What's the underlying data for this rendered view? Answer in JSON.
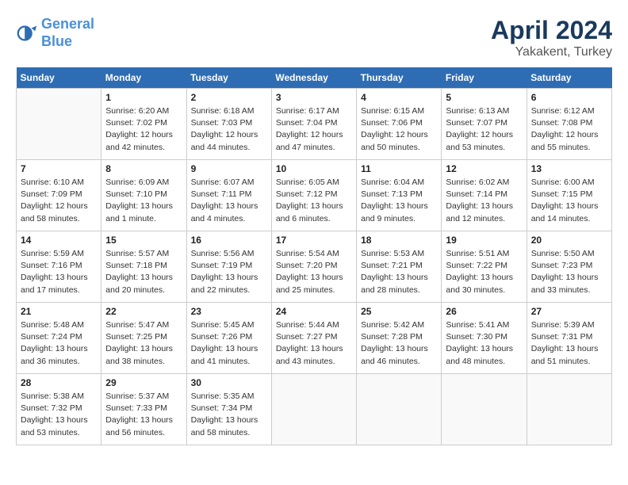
{
  "header": {
    "logo_line1": "General",
    "logo_line2": "Blue",
    "month": "April 2024",
    "location": "Yakakent, Turkey"
  },
  "weekdays": [
    "Sunday",
    "Monday",
    "Tuesday",
    "Wednesday",
    "Thursday",
    "Friday",
    "Saturday"
  ],
  "weeks": [
    [
      {
        "day": "",
        "info": ""
      },
      {
        "day": "1",
        "info": "Sunrise: 6:20 AM\nSunset: 7:02 PM\nDaylight: 12 hours\nand 42 minutes."
      },
      {
        "day": "2",
        "info": "Sunrise: 6:18 AM\nSunset: 7:03 PM\nDaylight: 12 hours\nand 44 minutes."
      },
      {
        "day": "3",
        "info": "Sunrise: 6:17 AM\nSunset: 7:04 PM\nDaylight: 12 hours\nand 47 minutes."
      },
      {
        "day": "4",
        "info": "Sunrise: 6:15 AM\nSunset: 7:06 PM\nDaylight: 12 hours\nand 50 minutes."
      },
      {
        "day": "5",
        "info": "Sunrise: 6:13 AM\nSunset: 7:07 PM\nDaylight: 12 hours\nand 53 minutes."
      },
      {
        "day": "6",
        "info": "Sunrise: 6:12 AM\nSunset: 7:08 PM\nDaylight: 12 hours\nand 55 minutes."
      }
    ],
    [
      {
        "day": "7",
        "info": "Sunrise: 6:10 AM\nSunset: 7:09 PM\nDaylight: 12 hours\nand 58 minutes."
      },
      {
        "day": "8",
        "info": "Sunrise: 6:09 AM\nSunset: 7:10 PM\nDaylight: 13 hours\nand 1 minute."
      },
      {
        "day": "9",
        "info": "Sunrise: 6:07 AM\nSunset: 7:11 PM\nDaylight: 13 hours\nand 4 minutes."
      },
      {
        "day": "10",
        "info": "Sunrise: 6:05 AM\nSunset: 7:12 PM\nDaylight: 13 hours\nand 6 minutes."
      },
      {
        "day": "11",
        "info": "Sunrise: 6:04 AM\nSunset: 7:13 PM\nDaylight: 13 hours\nand 9 minutes."
      },
      {
        "day": "12",
        "info": "Sunrise: 6:02 AM\nSunset: 7:14 PM\nDaylight: 13 hours\nand 12 minutes."
      },
      {
        "day": "13",
        "info": "Sunrise: 6:00 AM\nSunset: 7:15 PM\nDaylight: 13 hours\nand 14 minutes."
      }
    ],
    [
      {
        "day": "14",
        "info": "Sunrise: 5:59 AM\nSunset: 7:16 PM\nDaylight: 13 hours\nand 17 minutes."
      },
      {
        "day": "15",
        "info": "Sunrise: 5:57 AM\nSunset: 7:18 PM\nDaylight: 13 hours\nand 20 minutes."
      },
      {
        "day": "16",
        "info": "Sunrise: 5:56 AM\nSunset: 7:19 PM\nDaylight: 13 hours\nand 22 minutes."
      },
      {
        "day": "17",
        "info": "Sunrise: 5:54 AM\nSunset: 7:20 PM\nDaylight: 13 hours\nand 25 minutes."
      },
      {
        "day": "18",
        "info": "Sunrise: 5:53 AM\nSunset: 7:21 PM\nDaylight: 13 hours\nand 28 minutes."
      },
      {
        "day": "19",
        "info": "Sunrise: 5:51 AM\nSunset: 7:22 PM\nDaylight: 13 hours\nand 30 minutes."
      },
      {
        "day": "20",
        "info": "Sunrise: 5:50 AM\nSunset: 7:23 PM\nDaylight: 13 hours\nand 33 minutes."
      }
    ],
    [
      {
        "day": "21",
        "info": "Sunrise: 5:48 AM\nSunset: 7:24 PM\nDaylight: 13 hours\nand 36 minutes."
      },
      {
        "day": "22",
        "info": "Sunrise: 5:47 AM\nSunset: 7:25 PM\nDaylight: 13 hours\nand 38 minutes."
      },
      {
        "day": "23",
        "info": "Sunrise: 5:45 AM\nSunset: 7:26 PM\nDaylight: 13 hours\nand 41 minutes."
      },
      {
        "day": "24",
        "info": "Sunrise: 5:44 AM\nSunset: 7:27 PM\nDaylight: 13 hours\nand 43 minutes."
      },
      {
        "day": "25",
        "info": "Sunrise: 5:42 AM\nSunset: 7:28 PM\nDaylight: 13 hours\nand 46 minutes."
      },
      {
        "day": "26",
        "info": "Sunrise: 5:41 AM\nSunset: 7:30 PM\nDaylight: 13 hours\nand 48 minutes."
      },
      {
        "day": "27",
        "info": "Sunrise: 5:39 AM\nSunset: 7:31 PM\nDaylight: 13 hours\nand 51 minutes."
      }
    ],
    [
      {
        "day": "28",
        "info": "Sunrise: 5:38 AM\nSunset: 7:32 PM\nDaylight: 13 hours\nand 53 minutes."
      },
      {
        "day": "29",
        "info": "Sunrise: 5:37 AM\nSunset: 7:33 PM\nDaylight: 13 hours\nand 56 minutes."
      },
      {
        "day": "30",
        "info": "Sunrise: 5:35 AM\nSunset: 7:34 PM\nDaylight: 13 hours\nand 58 minutes."
      },
      {
        "day": "",
        "info": ""
      },
      {
        "day": "",
        "info": ""
      },
      {
        "day": "",
        "info": ""
      },
      {
        "day": "",
        "info": ""
      }
    ]
  ]
}
